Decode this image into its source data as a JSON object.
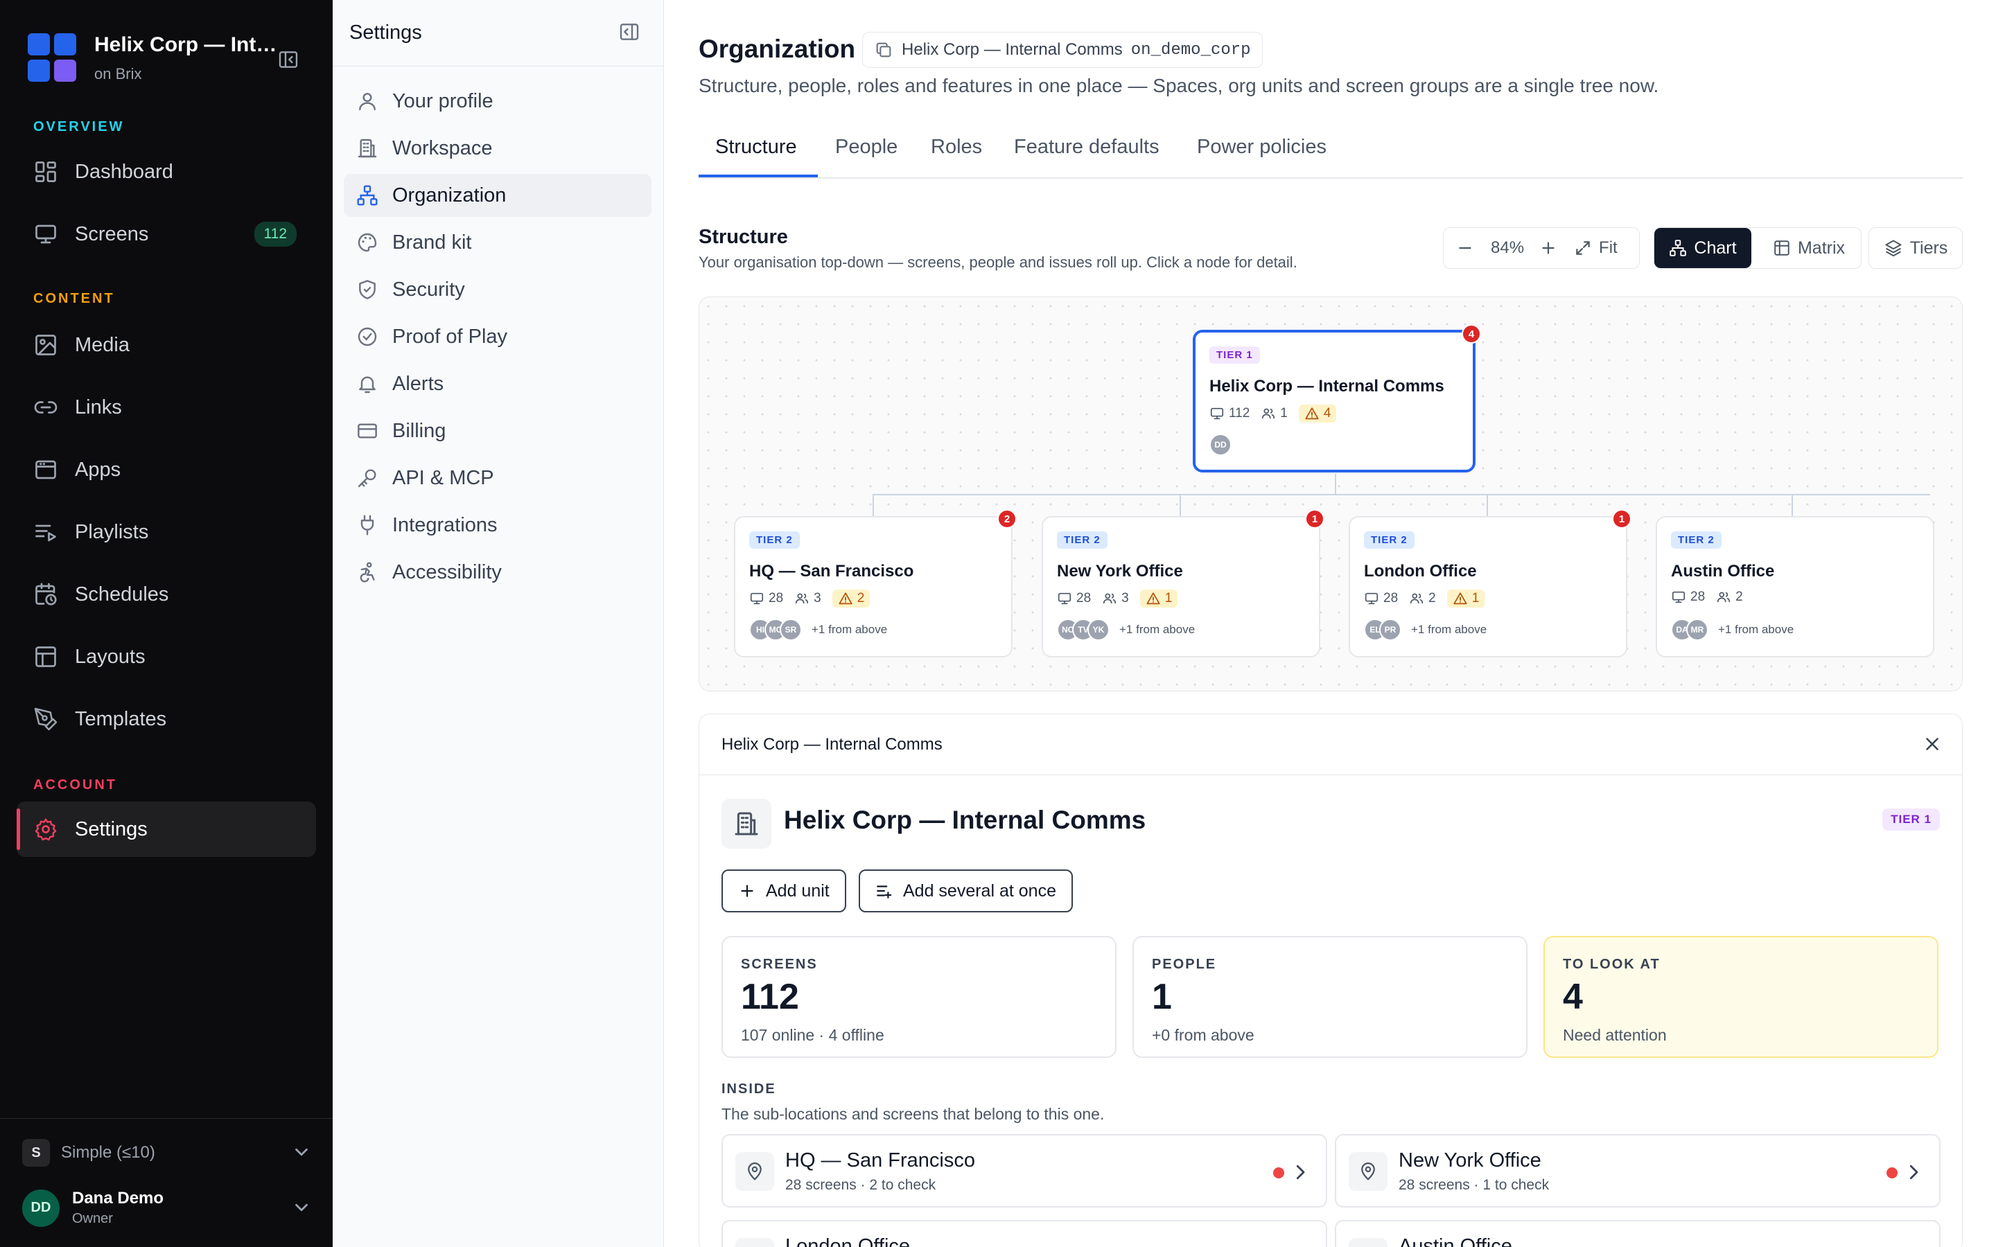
{
  "nav": {
    "brand_title": "Helix Corp — Internal Comms",
    "brand_sub": "on Brix",
    "sections": {
      "overview": "OVERVIEW",
      "content": "CONTENT",
      "account": "ACCOUNT"
    },
    "section_colors": {
      "overview": "#22d3ee",
      "content": "#f59e0b",
      "account": "#f43f5e"
    },
    "items": [
      {
        "label": "Dashboard",
        "icon": "dashboard-icon"
      },
      {
        "label": "Screens",
        "icon": "monitor-icon",
        "badge": "112"
      },
      {
        "label": "Media",
        "icon": "image-icon"
      },
      {
        "label": "Links",
        "icon": "link-icon"
      },
      {
        "label": "Apps",
        "icon": "app-window-icon"
      },
      {
        "label": "Playlists",
        "icon": "playlist-icon"
      },
      {
        "label": "Schedules",
        "icon": "calendar-clock-icon"
      },
      {
        "label": "Layouts",
        "icon": "layout-icon"
      },
      {
        "label": "Templates",
        "icon": "pen-tool-icon"
      },
      {
        "label": "Settings",
        "icon": "gear-icon",
        "active": true
      }
    ],
    "plan_letter": "S",
    "plan_label": "Simple (≤10)",
    "user": {
      "initials": "DD",
      "name": "Dana Demo",
      "role": "Owner"
    }
  },
  "settings": {
    "title": "Settings",
    "items": [
      {
        "label": "Your profile",
        "icon": "user-icon"
      },
      {
        "label": "Workspace",
        "icon": "building-icon"
      },
      {
        "label": "Organization",
        "icon": "org-tree-icon",
        "active": true
      },
      {
        "label": "Brand kit",
        "icon": "palette-icon"
      },
      {
        "label": "Security",
        "icon": "shield-icon"
      },
      {
        "label": "Proof of Play",
        "icon": "check-circle-icon"
      },
      {
        "label": "Alerts",
        "icon": "bell-icon"
      },
      {
        "label": "Billing",
        "icon": "credit-card-icon"
      },
      {
        "label": "API & MCP",
        "icon": "key-icon"
      },
      {
        "label": "Integrations",
        "icon": "plug-icon"
      },
      {
        "label": "Accessibility",
        "icon": "accessibility-icon"
      }
    ]
  },
  "main": {
    "title": "Organization",
    "chip_name": "Helix Corp — Internal Comms",
    "chip_code": "on_demo_corp",
    "subtitle": "Structure, people, roles and features in one place — Spaces, org units and screen groups are a single tree now.",
    "tabs": [
      {
        "label": "Structure",
        "active": true
      },
      {
        "label": "People"
      },
      {
        "label": "Roles"
      },
      {
        "label": "Feature defaults"
      },
      {
        "label": "Power policies"
      }
    ],
    "structure_title": "Structure",
    "structure_sub": "Your organisation top-down — screens, people and issues roll up. Click a node for detail.",
    "zoom_level": "84%",
    "fit_label": "Fit",
    "view_chart": "Chart",
    "view_matrix": "Matrix",
    "tiers_label": "Tiers",
    "accent": "#2563eb"
  },
  "tree": {
    "root": {
      "tier": "TIER 1",
      "name": "Helix Corp — Internal Comms",
      "screens": "112",
      "people": "1",
      "issues": "4",
      "badge": "4",
      "avatars": [
        "DD"
      ]
    },
    "children": [
      {
        "tier": "TIER 2",
        "name": "HQ — San Francisco",
        "screens": "28",
        "people": "3",
        "issues": "2",
        "badge": "2",
        "avatars": [
          "HI",
          "MC",
          "SR"
        ],
        "more": "+1 from above"
      },
      {
        "tier": "TIER 2",
        "name": "New York Office",
        "screens": "28",
        "people": "3",
        "issues": "1",
        "badge": "1",
        "avatars": [
          "NO",
          "TV",
          "YK"
        ],
        "more": "+1 from above"
      },
      {
        "tier": "TIER 2",
        "name": "London Office",
        "screens": "28",
        "people": "2",
        "issues": "1",
        "badge": "1",
        "avatars": [
          "EL",
          "PR"
        ],
        "more": "+1 from above"
      },
      {
        "tier": "TIER 2",
        "name": "Austin Office",
        "screens": "28",
        "people": "2",
        "issues": "",
        "badge": "",
        "avatars": [
          "DA",
          "MR"
        ],
        "more": "+1 from above"
      }
    ]
  },
  "detail": {
    "header": "Helix Corp — Internal Comms",
    "title": "Helix Corp — Internal Comms",
    "tier": "TIER 1",
    "add_unit": "Add unit",
    "add_several": "Add several at once",
    "stats": [
      {
        "label": "SCREENS",
        "value": "112",
        "note": "107 online · 4 offline"
      },
      {
        "label": "PEOPLE",
        "value": "1",
        "note": "+0 from above"
      },
      {
        "label": "TO LOOK AT",
        "value": "4",
        "note": "Need attention"
      }
    ],
    "inside_label": "INSIDE",
    "inside_sub": "The sub-locations and screens that belong to this one.",
    "inside": [
      {
        "name": "HQ — San Francisco",
        "meta": "28 screens · 2 to check"
      },
      {
        "name": "New York Office",
        "meta": "28 screens · 1 to check"
      },
      {
        "name": "London Office",
        "meta": ""
      },
      {
        "name": "Austin Office",
        "meta": ""
      }
    ]
  }
}
